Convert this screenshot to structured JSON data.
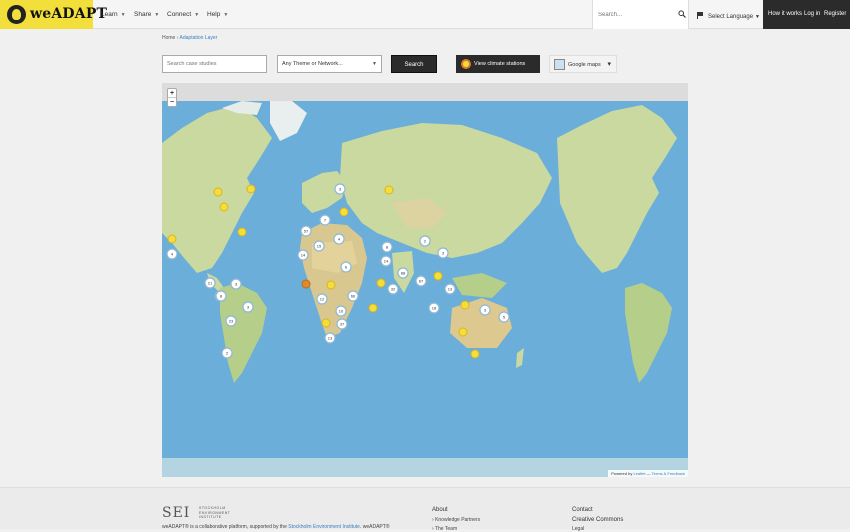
{
  "brand": {
    "name": "weADAPT"
  },
  "nav": {
    "items": [
      {
        "label": "Learn"
      },
      {
        "label": "Share"
      },
      {
        "label": "Connect"
      },
      {
        "label": "Help"
      }
    ],
    "search_placeholder": "Search...",
    "language": "Select Language",
    "account": {
      "how": "How it works",
      "login": "Log in",
      "register": "Register"
    }
  },
  "breadcrumb": {
    "home": "Home",
    "current": "Adaptation Layer"
  },
  "filters": {
    "search_placeholder": "Search case studies",
    "theme_select": "Any Theme or Network...",
    "search_button": "Search",
    "climate_button": "View climate stations",
    "gmaps_label": "Google maps"
  },
  "map": {
    "zoom_in": "+",
    "zoom_out": "−",
    "attribution_prefix": "Powered by",
    "attribution_leaflet": "Leaflet",
    "attribution_sep": "—",
    "attribution_terms": "Terms & Feedback",
    "clusters": [
      "3",
      "7",
      "57",
      "15",
      "4",
      "14",
      "4",
      "8",
      "14",
      "2",
      "3",
      "6",
      "88",
      "67",
      "13",
      "9",
      "66",
      "12",
      "32",
      "10",
      "37",
      "3",
      "23",
      "3",
      "8",
      "21",
      "3",
      "2",
      "2",
      "3",
      "5",
      "13",
      "18",
      "21"
    ]
  },
  "footer": {
    "sei_abbr": "SEI",
    "sei_full_1": "STOCKHOLM",
    "sei_full_2": "ENVIRONMENT",
    "sei_full_3": "INSTITUTE",
    "text_a": "weADAPT® is a collaborative platform, supported by the",
    "text_link": "Stockholm Environment Institute",
    "text_b": ". weADAPT®",
    "about_heading": "About",
    "about_link_1": "Knowledge Partners",
    "about_link_2": "The Team",
    "contact_heading": "Contact",
    "contact_link_1": "Creative Commons",
    "contact_link_2": "Legal"
  }
}
